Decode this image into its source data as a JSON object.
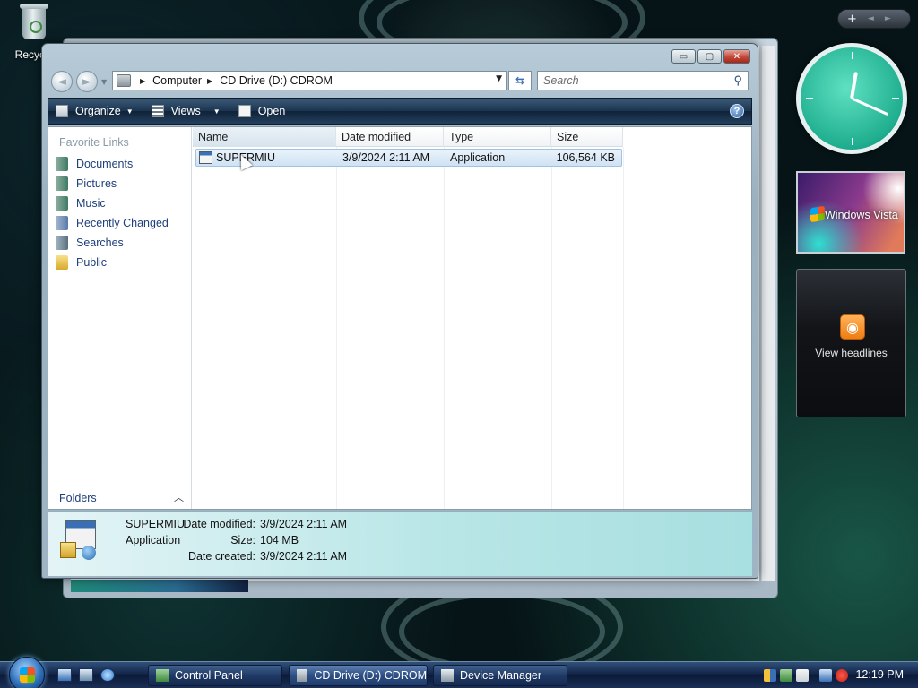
{
  "desktop": {
    "recycle_bin_label": "Recycle"
  },
  "window": {
    "buttons": {
      "minimize": "▭",
      "maximize": "▢",
      "close": "✕"
    },
    "address": {
      "crumbs": [
        "Computer",
        "CD Drive (D:) CDROM"
      ],
      "dropdown": "▼"
    },
    "search_placeholder": "Search",
    "toolbar": {
      "organize": "Organize",
      "views": "Views",
      "open": "Open",
      "help": "?"
    },
    "nav_pane": {
      "title": "Favorite Links",
      "links": [
        "Documents",
        "Pictures",
        "Music",
        "Recently Changed",
        "Searches",
        "Public"
      ],
      "folders_label": "Folders"
    },
    "columns": [
      "Name",
      "Date modified",
      "Type",
      "Size"
    ],
    "files": [
      {
        "name": "SUPERMIU",
        "date": "3/9/2024 2:11 AM",
        "type": "Application",
        "size": "106,564 KB",
        "selected": true
      }
    ],
    "details": {
      "name": "SUPERMIU",
      "type": "Application",
      "date_modified_label": "Date modified:",
      "date_modified": "3/9/2024 2:11 AM",
      "size_label": "Size:",
      "size": "104 MB",
      "date_created_label": "Date created:",
      "date_created": "3/9/2024 2:11 AM"
    }
  },
  "gadgets": {
    "controls": {
      "add": "+",
      "prev": "◄",
      "next": "►"
    },
    "clock_time": {
      "hour": 12,
      "minute": 19
    },
    "slideshow_text": "Windows Vista",
    "feed_text": "View headlines"
  },
  "taskbar": {
    "tasks": [
      "Control Panel",
      "CD Drive (D:) CDROM",
      "Device Manager"
    ],
    "clock": "12:19 PM"
  },
  "colors": {
    "link_blue": "#1e3f7a",
    "taskbar_dark": "#0b1a36",
    "selection": "#cfe2f3",
    "clock_face": "#1fae8f"
  }
}
